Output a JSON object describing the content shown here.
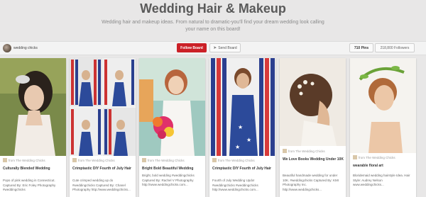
{
  "board": {
    "title": "Wedding Hair & Makeup",
    "description": "Wedding hair and makeup ideas. From natural to dramatic-you'll find your dream wedding look calling your name on this board!"
  },
  "owner": {
    "name": "wedding chicks"
  },
  "actions": {
    "follow_label": "Follow Board",
    "send_label": "Send Board"
  },
  "stats": {
    "pins": "710 Pins",
    "followers": "218,800 Followers"
  },
  "pins": [
    {
      "source": "from The Wedding Chicks",
      "title": "Culturally Blended Wedding",
      "body": "Pops of pink wedding in Connecticut. Captured By: Eric Foley Photography #weddingchicks"
    },
    {
      "source": "from The Wedding Chicks",
      "title": "Crimptastic DIY Fourth of July Hair",
      "body": "Cute crimped wedding up do #weddingchicks Captured By: Chanel Photography http://www.weddingchicks..."
    },
    {
      "source": "from The Wedding Chicks",
      "title": "Bright Bold Beautiful Wedding",
      "body": "Bright, bold wedding #weddingchicks Captured By: Rachel V Photography http://www.weddingchicks.com..."
    },
    {
      "source": "from The Wedding Chicks",
      "title": "Crimptastic DIY Fourth of July Hair",
      "body": "Fourth of July Wedding Updo! #weddingchicks #weddingchicks http://www.weddingchicks.com..."
    },
    {
      "source": "from The Wedding Chicks",
      "title": "We Love Books Wedding Under 10K",
      "body": "Beautiful handmade wedding for under 10K. #weddingchicks Captured By: KMI Photography Inc. http://www.weddingchicks..."
    },
    {
      "source": "from The Wedding Chicks",
      "title": "wearable floral art",
      "body": "Bloridemaid wedding hairstyle Idea. Hair Style: Audrey Nelson www.weddingchicks..."
    }
  ]
}
